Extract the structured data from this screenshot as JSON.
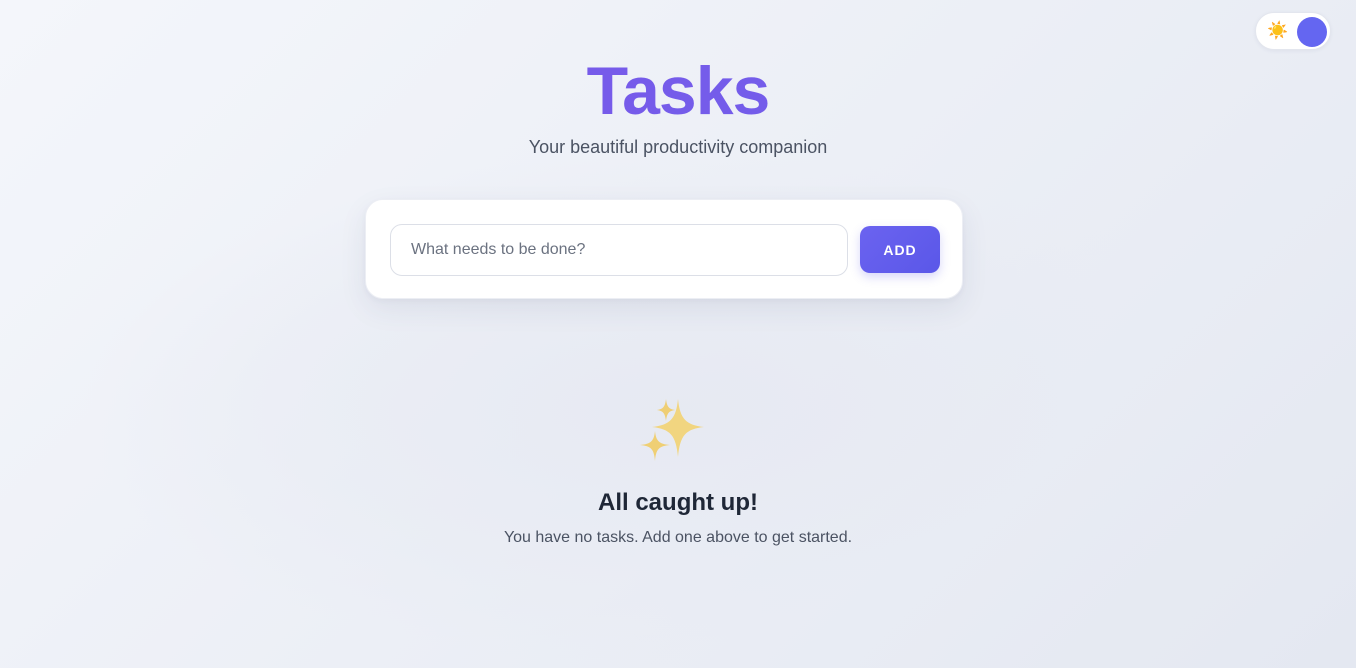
{
  "theme_toggle": {
    "icon": "sun-icon",
    "glyph": "☀️",
    "knob_color": "#6466f1"
  },
  "header": {
    "title": "Tasks",
    "subtitle": "Your beautiful productivity companion",
    "title_color": "#7b5ce8"
  },
  "task_form": {
    "input_value": "",
    "input_placeholder": "What needs to be done?",
    "add_label": "ADD",
    "accent_color": "#5f5ce9"
  },
  "empty_state": {
    "icon": "sparkles-icon",
    "title": "All caught up!",
    "description": "You have no tasks. Add one above to get started."
  }
}
